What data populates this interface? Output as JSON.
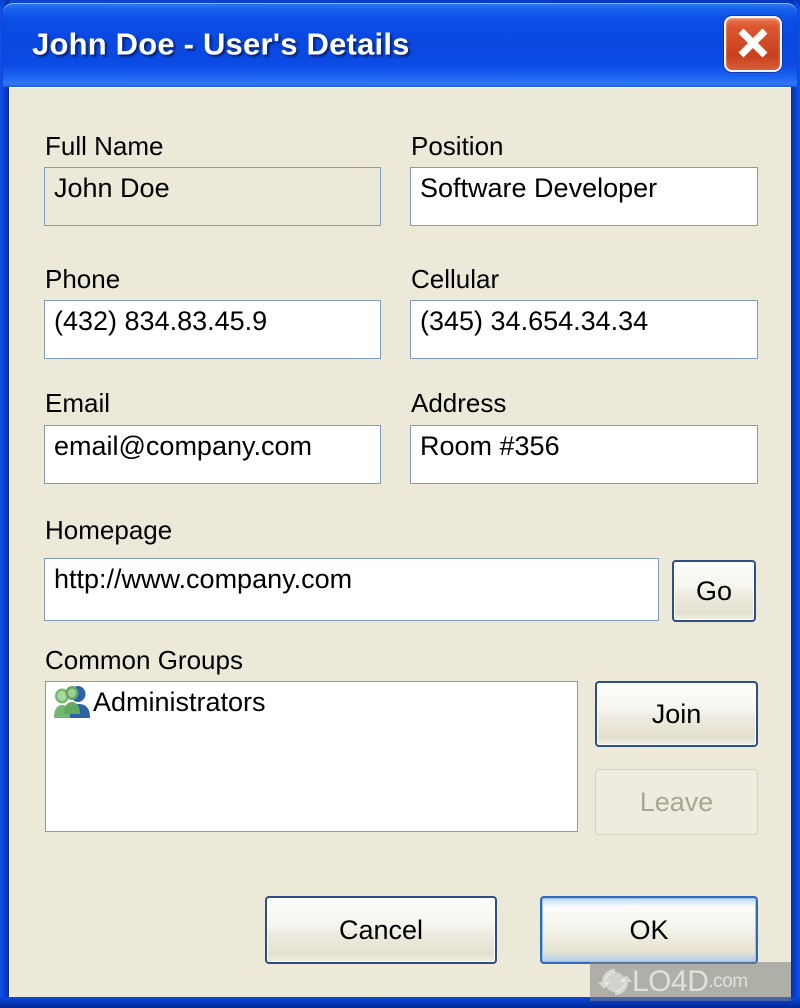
{
  "window": {
    "title": "John Doe  -  User's Details",
    "close_icon": "close-icon",
    "background_color": "#ECE9D8",
    "titlebar_color": "#0A47DF",
    "close_button_color": "#C9401D"
  },
  "fields": {
    "full_name": {
      "label": "Full Name",
      "value": "John Doe",
      "readonly": true
    },
    "position": {
      "label": "Position",
      "value": "Software Developer",
      "readonly": false
    },
    "phone": {
      "label": "Phone",
      "value": "(432) 834.83.45.9",
      "readonly": false
    },
    "cellular": {
      "label": "Cellular",
      "value": "(345) 34.654.34.34",
      "readonly": false
    },
    "email": {
      "label": "Email",
      "value": "email@company.com",
      "readonly": false
    },
    "address": {
      "label": "Address",
      "value": "Room #356",
      "readonly": false
    },
    "homepage": {
      "label": "Homepage",
      "value": "http://www.company.com",
      "readonly": false
    }
  },
  "buttons": {
    "go": {
      "label": "Go",
      "state": "default"
    },
    "join": {
      "label": "Join",
      "state": "default"
    },
    "leave": {
      "label": "Leave",
      "state": "disabled"
    },
    "cancel": {
      "label": "Cancel",
      "state": "default"
    },
    "ok": {
      "label": "OK",
      "state": "accent"
    }
  },
  "groups": {
    "label": "Common Groups",
    "items": [
      {
        "name": "Administrators",
        "icon": "users-group-icon"
      }
    ]
  },
  "watermark": {
    "name": "LO4D",
    "tld": ".com",
    "icon": "refresh-circle-icon"
  }
}
